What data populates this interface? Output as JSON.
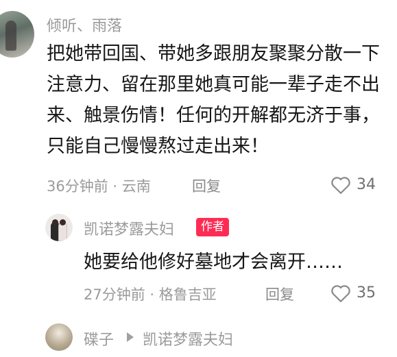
{
  "comments": [
    {
      "author": "倾听、雨落",
      "lines": [
        "把她带回国、带她多跟朋友聚聚分散一下",
        "注意力、留在那里她真可能一辈子走不出",
        "来、触景伤情！任何的开解都无济于事，",
        "只能自己慢慢熬过走出来！"
      ],
      "time_location": "36分钟前 · 云南",
      "reply_label": "回复",
      "likes": "34"
    },
    {
      "author": "凯诺梦露夫妇",
      "badge": "作者",
      "lines": [
        "她要给他修好墓地才会离开……"
      ],
      "time_location": "27分钟前 · 格鲁吉亚",
      "reply_label": "回复",
      "likes": "35"
    },
    {
      "author": "碟子",
      "reply_to": "凯诺梦露夫妇"
    }
  ],
  "colors": {
    "badge_bg": "#fe2c55",
    "meta_text": "#9a9a9a"
  }
}
